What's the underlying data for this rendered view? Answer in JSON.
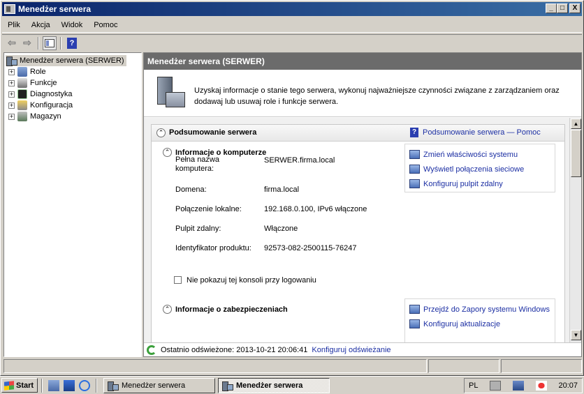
{
  "window": {
    "title": "Menedżer serwera",
    "controls": {
      "minimize": "_",
      "maximize": "□",
      "close": "X"
    }
  },
  "menu": [
    "Plik",
    "Akcja",
    "Widok",
    "Pomoc"
  ],
  "tree": {
    "root": "Menedżer serwera (SERWER)",
    "items": [
      {
        "label": "Role",
        "icon": "roles-icon"
      },
      {
        "label": "Funkcje",
        "icon": "features-icon"
      },
      {
        "label": "Diagnostyka",
        "icon": "diagnostics-icon"
      },
      {
        "label": "Konfiguracja",
        "icon": "configuration-icon"
      },
      {
        "label": "Magazyn",
        "icon": "storage-icon"
      }
    ]
  },
  "content": {
    "header": "Menedżer serwera (SERWER)",
    "intro": "Uzyskaj informacje o stanie tego serwera, wykonuj najważniejsze czynności związane z zarządzaniem oraz dodawaj lub usuwaj role i funkcje serwera.",
    "summary": {
      "title": "Podsumowanie serwera",
      "help_link": "Podsumowanie serwera — Pomoc",
      "computer_info": {
        "title": "Informacje o komputerze",
        "fields": [
          {
            "label": "Pełna nazwa komputera:",
            "value": "SERWER.firma.local"
          },
          {
            "label": "Domena:",
            "value": "firma.local"
          },
          {
            "label": "Połączenie lokalne:",
            "value": "192.168.0.100, IPv6 włączone"
          },
          {
            "label": "Pulpit zdalny:",
            "value": "Włączone"
          },
          {
            "label": "Identyfikator produktu:",
            "value": "92573-082-2500115-76247"
          }
        ],
        "actions": [
          "Zmień właściwości systemu",
          "Wyświetl połączenia sieciowe",
          "Konfiguruj pulpit zdalny"
        ],
        "checkbox_label": "Nie pokazuj tej konsoli przy logowaniu"
      },
      "security_info": {
        "title": "Informacje o zabezpieczeniach",
        "actions": [
          "Przejdź do Zapory systemu Windows",
          "Konfiguruj aktualizacje"
        ]
      }
    },
    "status": {
      "label": "Ostatnio odświeżone: 2013-10-21 20:06:41",
      "link": "Konfiguruj odświeżanie"
    }
  },
  "taskbar": {
    "start": "Start",
    "tasks": [
      "Menedżer serwera",
      "Menedżer serwera"
    ],
    "language": "PL",
    "clock": "20:07"
  }
}
